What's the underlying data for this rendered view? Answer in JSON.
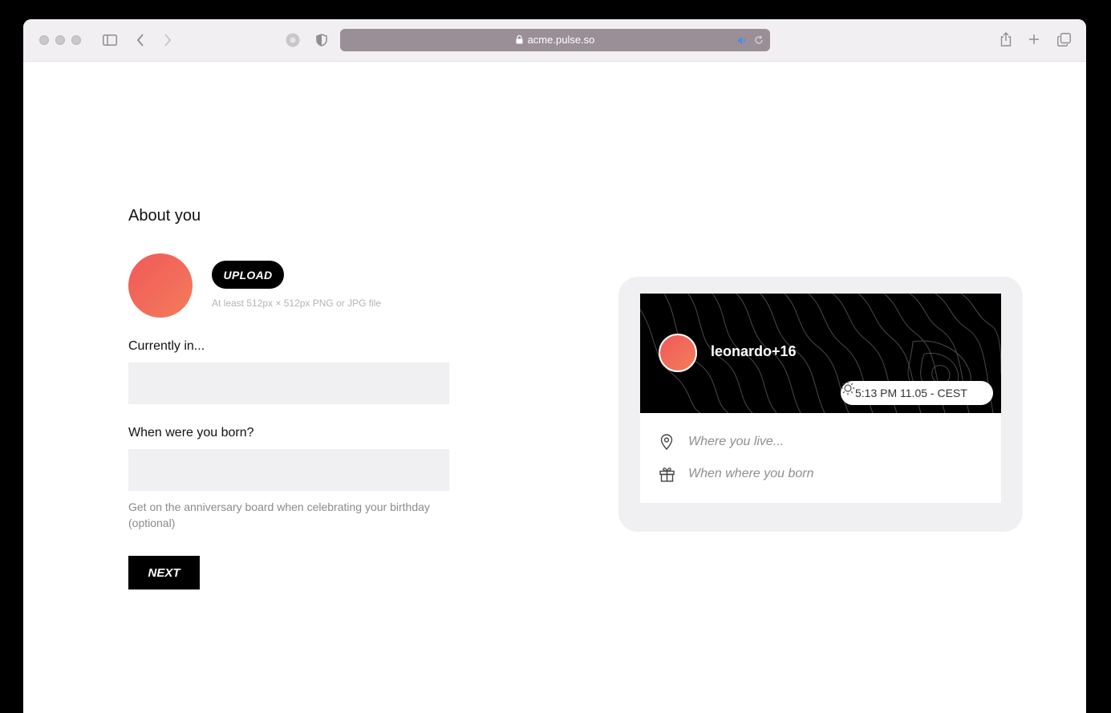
{
  "browser": {
    "url": "acme.pulse.so",
    "icons": [
      "sidebar-icon",
      "back-icon",
      "forward-icon",
      "extension-icon",
      "shield-icon",
      "lock-icon",
      "audio-icon",
      "reload-icon",
      "share-icon",
      "new-tab-icon",
      "tabs-overview-icon"
    ]
  },
  "form": {
    "title": "About you",
    "upload_label": "UPLOAD",
    "upload_hint": "At least 512px × 512px PNG or JPG file",
    "location_label": "Currently in...",
    "location_value": "",
    "birthday_label": "When were you born?",
    "birthday_value": "",
    "birthday_helper": "Get on the anniversary board when celebrating your birthday (optional)",
    "next_label": "NEXT"
  },
  "preview": {
    "name": "leonardo+16",
    "time": "5:13 PM 11.05 - CEST",
    "location_placeholder": "Where you live...",
    "birthday_placeholder": "When where you born"
  },
  "colors": {
    "avatar_gradient_start": "#f05a5b",
    "avatar_gradient_end": "#f47d59",
    "field_bg": "#f0eff1",
    "button_bg": "#000000",
    "address_bar": "#9a8f97"
  }
}
